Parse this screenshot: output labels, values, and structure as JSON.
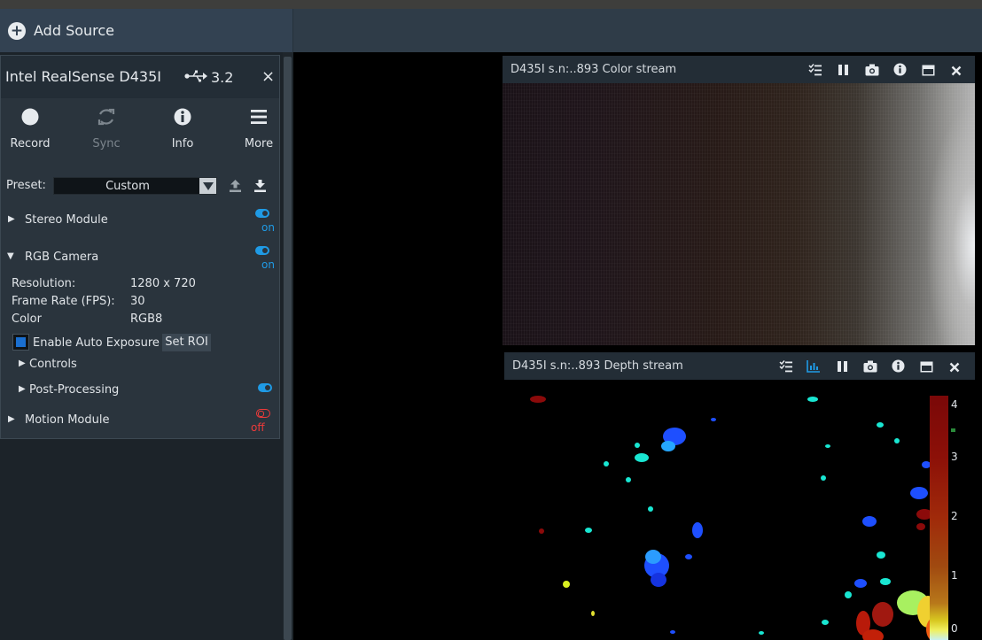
{
  "toolbar": {
    "add_source_label": "Add Source",
    "add_icon": "plus-circle-icon"
  },
  "device": {
    "name": "Intel RealSense D435I",
    "usb_version": "3.2",
    "usb_icon": "usb-icon",
    "close_glyph": "×",
    "tools": [
      {
        "label": "Record",
        "icon": "record-icon",
        "enabled": true
      },
      {
        "label": "Sync",
        "icon": "sync-icon",
        "enabled": false
      },
      {
        "label": "Info",
        "icon": "info-icon",
        "enabled": true
      },
      {
        "label": "More",
        "icon": "menu-icon",
        "enabled": true
      }
    ],
    "preset": {
      "label": "Preset:",
      "value": "Custom"
    }
  },
  "modules": {
    "stereo": {
      "label": "Stereo Module",
      "state": "on",
      "expanded": false
    },
    "rgb": {
      "label": "RGB Camera",
      "state": "on",
      "expanded": true,
      "settings": [
        {
          "key": "Resolution:",
          "value": "1280 x 720"
        },
        {
          "key": "Frame Rate (FPS):",
          "value": "30"
        },
        {
          "key": "Color",
          "value": "RGB8"
        }
      ],
      "auto_exposure_label": "Enable Auto Exposure",
      "auto_exposure_checked": true,
      "roi_button": "Set ROI",
      "controls_label": "Controls",
      "post_processing_label": "Post-Processing",
      "post_processing_state": "on"
    },
    "motion": {
      "label": "Motion Module",
      "state": "off",
      "expanded": false
    }
  },
  "streams": {
    "color": {
      "title": "D435I s.n:..893 Color stream"
    },
    "depth": {
      "title": "D435I s.n:..893 Depth stream",
      "colorbar_ticks": [
        "4",
        "3",
        "2",
        "1",
        "0"
      ]
    }
  },
  "colors": {
    "accent_on": "#1f9be6",
    "accent_off": "#ee3a3a",
    "checkbox_fill": "#1a6fd0"
  }
}
